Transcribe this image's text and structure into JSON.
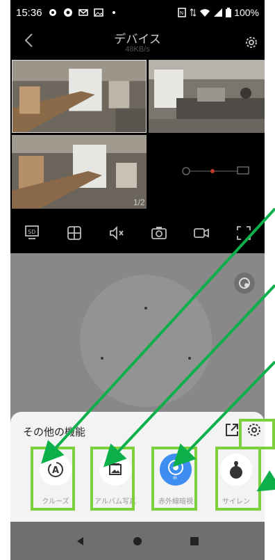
{
  "status": {
    "time": "15:36",
    "battery": "100%",
    "left_icons": [
      "gear-icon",
      "record-icon",
      "mail-icon",
      "image-icon",
      "dot-icon"
    ],
    "right_icons": [
      "nfc-icon",
      "data-icon",
      "wifi-icon",
      "signal-icon",
      "battery-icon"
    ]
  },
  "header": {
    "title": "デバイス",
    "speed": "48KB/s"
  },
  "grid": {
    "page": "1/2"
  },
  "toolbar": {
    "items": [
      "sd-card-icon",
      "grid-layout-icon",
      "mute-icon",
      "camera-icon",
      "record-video-icon",
      "fullscreen-icon"
    ]
  },
  "sheet": {
    "title": "その他の機能",
    "functions": [
      {
        "label": "クルーズ",
        "icon": "cruise-icon"
      },
      {
        "label": "アルバム写真",
        "icon": "album-icon"
      },
      {
        "label": "赤外線暗視",
        "icon": "infrared-icon",
        "badge": "IR"
      },
      {
        "label": "サイレン",
        "icon": "siren-icon"
      }
    ]
  },
  "colors": {
    "highlight": "#7ed03c",
    "arrow": "#0bb04a",
    "ir_blue": "#3d8ef0"
  }
}
